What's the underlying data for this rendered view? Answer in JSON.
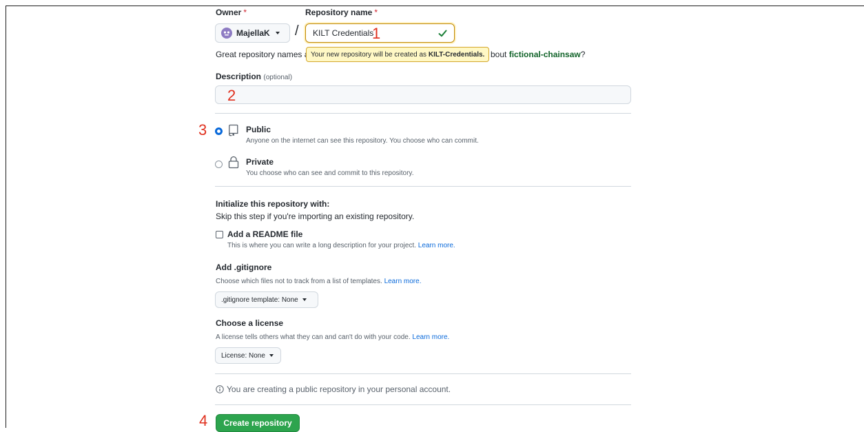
{
  "form": {
    "owner_label": "Owner",
    "repo_label": "Repository name",
    "required_mark": "*",
    "owner_value": "MajellaK",
    "slash": "/",
    "repo_value": "KILT Credentials",
    "hint_before": "Great repository names a",
    "hint_after": "bout",
    "suggestion": "fictional-chainsaw",
    "hint_end": "?",
    "tooltip_prefix": "Your new repository will be created as",
    "tooltip_name": "KILT-Credentials.",
    "description_label": "Description",
    "description_optional": "(optional)",
    "description_value": "",
    "visibility": [
      {
        "label": "Public",
        "desc": "Anyone on the internet can see this repository. You choose who can commit.",
        "checked": true
      },
      {
        "label": "Private",
        "desc": "You choose who can see and commit to this repository.",
        "checked": false
      }
    ],
    "init_title": "Initialize this repository with:",
    "init_sub": "Skip this step if you're importing an existing repository.",
    "readme_label": "Add a README file",
    "readme_desc": "This is where you can write a long description for your project.",
    "gitignore_title": "Add .gitignore",
    "gitignore_desc": "Choose which files not to track from a list of templates.",
    "gitignore_select": ".gitignore template: None",
    "license_title": "Choose a license",
    "license_desc": "A license tells others what they can and can't do with your code.",
    "license_select": "License: None",
    "learn_more": "Learn more.",
    "notice": "You are creating a public repository in your personal account.",
    "create_button": "Create repository"
  },
  "annotations": [
    "1",
    "2",
    "3",
    "4"
  ],
  "colors": {
    "accent": "#0969da",
    "success": "#2da44e",
    "annotation": "#e0301e",
    "tooltip_bg": "#fff8c5"
  },
  "icons": [
    "avatar-icon",
    "check-icon",
    "repo-icon",
    "lock-icon",
    "info-icon",
    "caret-down-icon"
  ]
}
